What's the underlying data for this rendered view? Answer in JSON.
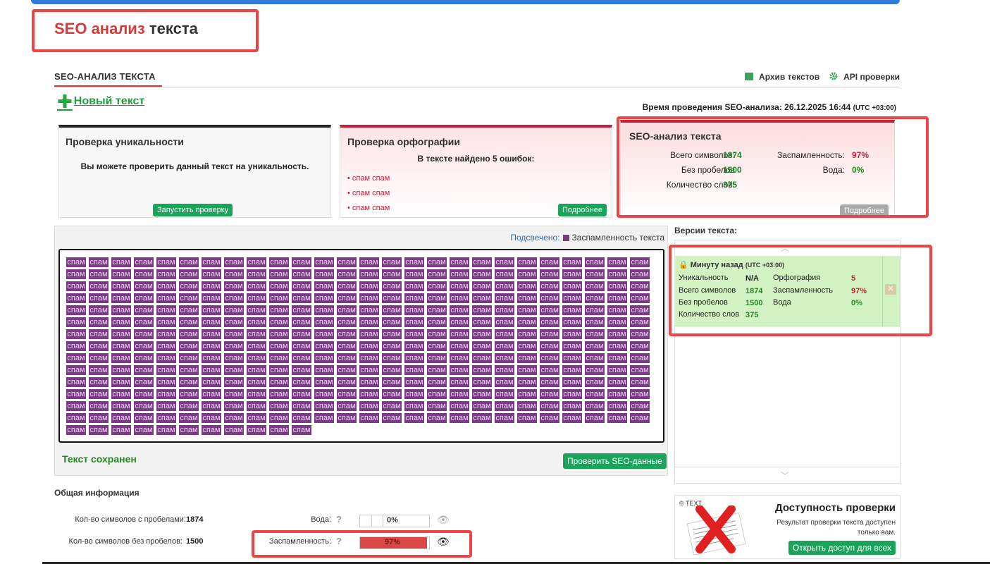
{
  "page_title": {
    "part1": "SEO анализ",
    "part2": "текста"
  },
  "section": {
    "title": "SEO-АНАЛИЗ ТЕКСТА"
  },
  "toplinks": {
    "archive": "Архив текстов",
    "api": "API проверки"
  },
  "new_text": {
    "label": "Новый текст"
  },
  "analysis_time": {
    "label": "Время проведения SEO-анализа: 26.12.2025 16:44",
    "tz": "(UTC +03:00)"
  },
  "uniqueness": {
    "title": "Проверка уникальности",
    "message": "Вы можете проверить данный текст на уникальность.",
    "button": "Запустить проверку"
  },
  "spelling": {
    "title": "Проверка орфографии",
    "summary": "В тексте найдено 5 ошибок:",
    "errors": [
      "спам спам",
      "спам спам",
      "спам спам"
    ],
    "button": "Подробнее"
  },
  "seo": {
    "title": "SEO-анализ текста",
    "total_chars_label": "Всего символов:",
    "total_chars": "1874",
    "no_spaces_label": "Без пробелов",
    "no_spaces": "1500",
    "words_label": "Количество слов:",
    "words": "375",
    "spam_label": "Заспамленность:",
    "spam": "97%",
    "water_label": "Вода:",
    "water": "0%",
    "button": "Подробнее"
  },
  "editor": {
    "highlight_label": "Подсвечено:",
    "highlight_value": "Заспамленность текста",
    "word": "спам",
    "word_count": 375,
    "saved": "Текст сохранен",
    "check_button": "Проверить SEO-данные"
  },
  "versions": {
    "title": "Версии текста:",
    "item": {
      "time": "Минуту назад",
      "tz": "(UTC +03:00)",
      "uniq_label": "Уникальность",
      "uniq": "N/A",
      "total_label": "Всего символов",
      "total": "1874",
      "nospace_label": "Без пробелов",
      "nospace": "1500",
      "words_label": "Количество слов",
      "words": "375",
      "spell_label": "Орфография",
      "spell": "5",
      "spam_label": "Заспамленность",
      "spam": "97%",
      "water_label": "Вода",
      "water": "0%"
    }
  },
  "general": {
    "title": "Общая информация",
    "chars_with_spaces_label": "Кол-во символов с пробелами:",
    "chars_with_spaces": "1874",
    "chars_no_spaces_label": "Кол-во символов без пробелов:",
    "chars_no_spaces": "1500",
    "water_label": "Вода:",
    "water_pct": "0%",
    "water_fraction": 0.0,
    "spam_label": "Заспамленность:",
    "spam_pct": "97%",
    "spam_fraction": 0.97,
    "help": "?"
  },
  "access": {
    "title": "Доступность проверки",
    "desc1": "Результат проверки текста доступен",
    "desc2": "только вам.",
    "button": "Открыть доступ для всех",
    "logo_text": "© TEXT"
  },
  "colors": {
    "accent_red": "#d33b3b",
    "green": "#1aa35a",
    "highlight": "#7b3a86",
    "annotation": "#ef4444"
  }
}
